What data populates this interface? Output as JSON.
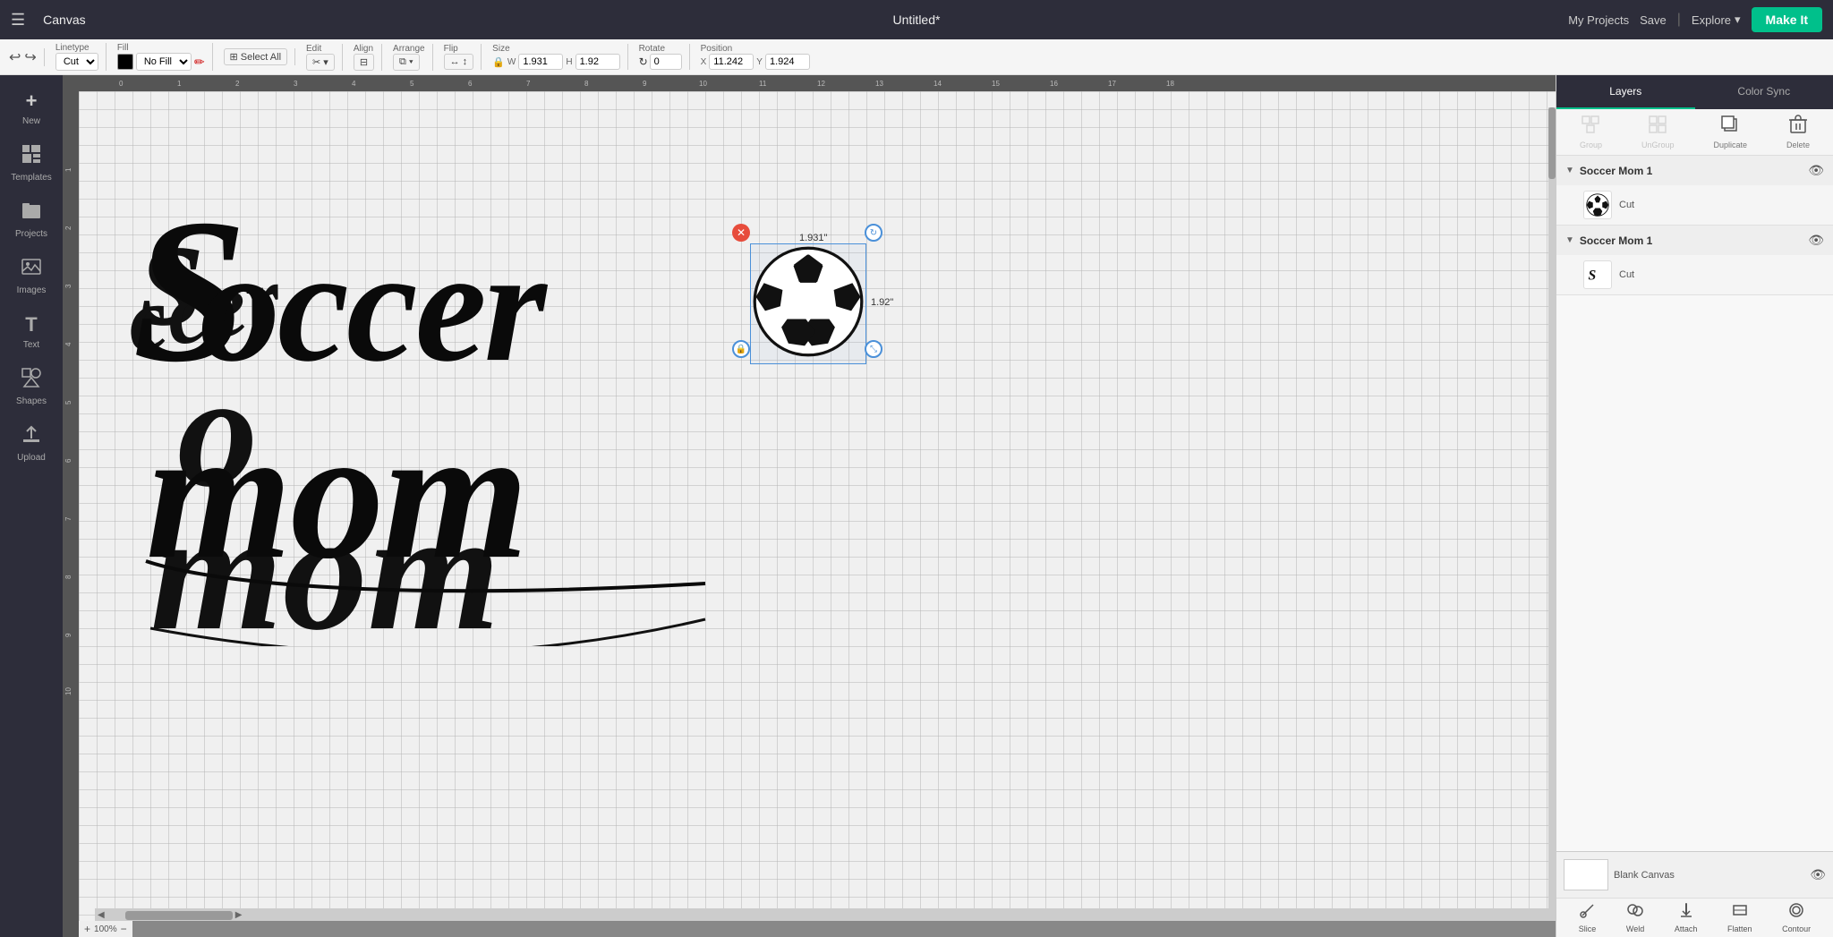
{
  "app": {
    "name": "Canvas",
    "doc_title": "Untitled*"
  },
  "topbar": {
    "my_projects": "My Projects",
    "save": "Save",
    "divider": "|",
    "explore": "Explore",
    "make_it": "Make It"
  },
  "toolbar": {
    "linetype_label": "Linetype",
    "linetype_value": "Cut",
    "fill_label": "Fill",
    "fill_value": "No Fill",
    "select_all": "Select All",
    "edit": "Edit",
    "align": "Align",
    "arrange": "Arrange",
    "flip": "Flip",
    "size_label": "Size",
    "size_w_label": "W",
    "size_w_value": "1.931",
    "size_h_label": "H",
    "size_h_value": "1.92",
    "rotate_label": "Rotate",
    "rotate_value": "0",
    "position_label": "Position",
    "pos_x_label": "X",
    "pos_x_value": "11.242",
    "pos_y_label": "Y",
    "pos_y_value": "1.924"
  },
  "sidebar": {
    "items": [
      {
        "id": "new",
        "label": "New",
        "icon": "+"
      },
      {
        "id": "templates",
        "label": "Templates",
        "icon": "▦"
      },
      {
        "id": "projects",
        "label": "Projects",
        "icon": "📁"
      },
      {
        "id": "images",
        "label": "Images",
        "icon": "🖼"
      },
      {
        "id": "text",
        "label": "Text",
        "icon": "T"
      },
      {
        "id": "shapes",
        "label": "Shapes",
        "icon": "◻"
      },
      {
        "id": "upload",
        "label": "Upload",
        "icon": "↑"
      }
    ]
  },
  "canvas": {
    "zoom": "100%",
    "dim_width": "1.931\"",
    "dim_height": "1.92\""
  },
  "layers": {
    "tabs": [
      "Layers",
      "Color Sync"
    ],
    "actions": [
      {
        "id": "group",
        "label": "Group",
        "icon": "⊞"
      },
      {
        "id": "ungroup",
        "label": "UnGroup",
        "icon": "⊟"
      },
      {
        "id": "duplicate",
        "label": "Duplicate",
        "icon": "⧉"
      },
      {
        "id": "delete",
        "label": "Delete",
        "icon": "🗑"
      }
    ],
    "groups": [
      {
        "id": "group1",
        "title": "Soccer Mom 1",
        "expanded": true,
        "items": [
          {
            "id": "item1",
            "label": "Cut",
            "thumb": "⚽"
          }
        ]
      },
      {
        "id": "group2",
        "title": "Soccer Mom 1",
        "expanded": true,
        "items": [
          {
            "id": "item2",
            "label": "Cut",
            "thumb": "✍"
          }
        ]
      }
    ]
  },
  "bottom_panel": {
    "blank_canvas_label": "Blank Canvas"
  },
  "bottom_toolbar": {
    "items": [
      {
        "id": "slice",
        "label": "Slice",
        "icon": "✂"
      },
      {
        "id": "weld",
        "label": "Weld",
        "icon": "⊕"
      },
      {
        "id": "attach",
        "label": "Attach",
        "icon": "📎"
      },
      {
        "id": "flatten",
        "label": "Flatten",
        "icon": "⧖"
      },
      {
        "id": "contour",
        "label": "Contour",
        "icon": "⬡"
      }
    ]
  }
}
